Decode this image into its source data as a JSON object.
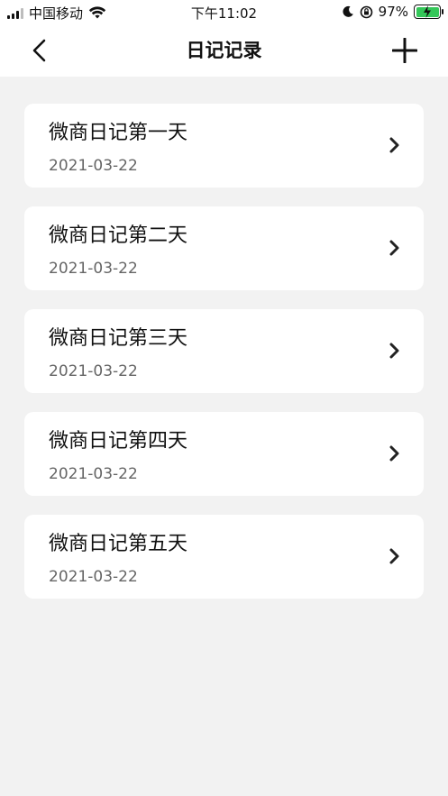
{
  "status_bar": {
    "carrier": "中国移动",
    "time": "下午11:02",
    "battery_percent": "97%",
    "icons": [
      "signal-icon",
      "wifi-icon",
      "moon-icon",
      "orientation-lock-icon",
      "battery-charging-icon"
    ]
  },
  "nav": {
    "title": "日记记录",
    "back_icon": "chevron-left-icon",
    "add_icon": "plus-icon"
  },
  "diary_entries": [
    {
      "title": "微商日记第一天",
      "date": "2021-03-22"
    },
    {
      "title": "微商日记第二天",
      "date": "2021-03-22"
    },
    {
      "title": "微商日记第三天",
      "date": "2021-03-22"
    },
    {
      "title": "微商日记第四天",
      "date": "2021-03-22"
    },
    {
      "title": "微商日记第五天",
      "date": "2021-03-22"
    }
  ],
  "colors": {
    "background": "#f2f2f2",
    "card": "#ffffff",
    "battery_fill": "#34c759",
    "date_text": "#666666"
  }
}
